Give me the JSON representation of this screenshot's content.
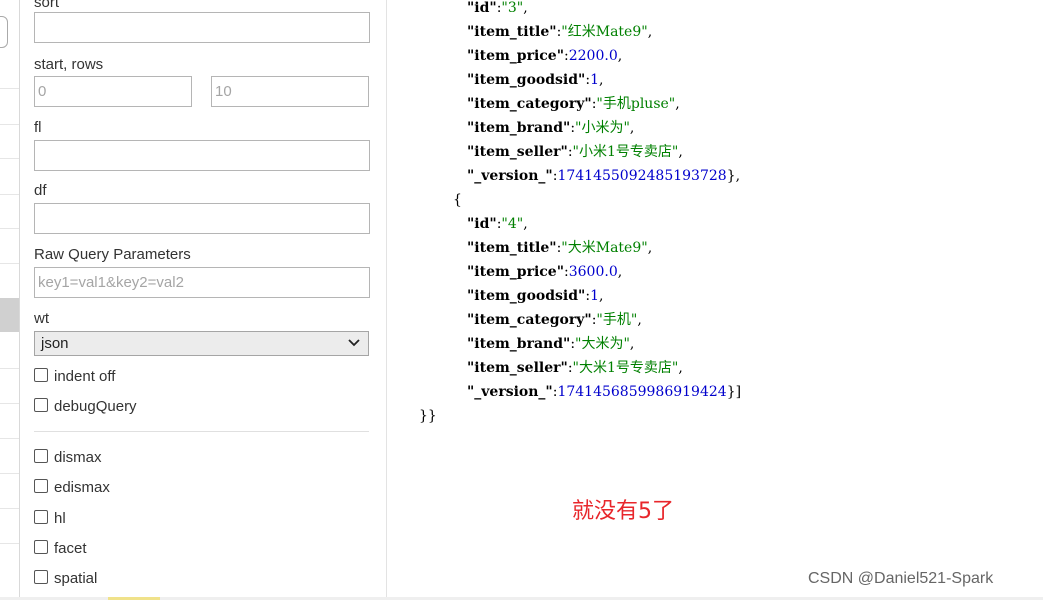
{
  "form": {
    "sort_label": "sort",
    "sort_value": "",
    "start_rows_label": "start, rows",
    "start_placeholder": "0",
    "rows_placeholder": "10",
    "fl_label": "fl",
    "fl_value": "",
    "df_label": "df",
    "df_value": "",
    "raw_label": "Raw Query Parameters",
    "raw_placeholder": "key1=val1&key2=val2",
    "wt_label": "wt",
    "wt_selected": "json",
    "checkboxes": [
      {
        "label": "indent off",
        "checked": false
      },
      {
        "label": "debugQuery",
        "checked": false
      },
      {
        "label": "dismax",
        "checked": false
      },
      {
        "label": "edismax",
        "checked": false
      },
      {
        "label": "hl",
        "checked": false
      },
      {
        "label": "facet",
        "checked": false
      },
      {
        "label": "spatial",
        "checked": false
      }
    ]
  },
  "response": {
    "doc3": {
      "id": "\"3\"",
      "item_title": "\"红米Mate9\"",
      "item_price": "2200.0",
      "item_goodsid": "1",
      "item_category": "\"手机pluse\"",
      "item_brand": "\"小米为\"",
      "item_seller": "\"小米1号专卖店\"",
      "_version_": "1741455092485193728"
    },
    "doc4": {
      "id": "\"4\"",
      "item_title": "\"大米Mate9\"",
      "item_price": "3600.0",
      "item_goodsid": "1",
      "item_category": "\"手机\"",
      "item_brand": "\"大米为\"",
      "item_seller": "\"大米1号专卖店\"",
      "_version_": "1741456859986919424"
    },
    "keys": {
      "id": "\"id\"",
      "item_title": "\"item_title\"",
      "item_price": "\"item_price\"",
      "item_goodsid": "\"item_goodsid\"",
      "item_category": "\"item_category\"",
      "item_brand": "\"item_brand\"",
      "item_seller": "\"item_seller\"",
      "_version_": "\"_version_\""
    },
    "open_brace": "{",
    "close_doc3": "},",
    "close_doc4": "}]",
    "close_all": "}}"
  },
  "annotation": "就没有5了",
  "watermark": "CSDN @Daniel521-Spark",
  "colors": {
    "json_string": "#008000",
    "json_number": "#0000cc",
    "annotation": "#e8262b"
  }
}
